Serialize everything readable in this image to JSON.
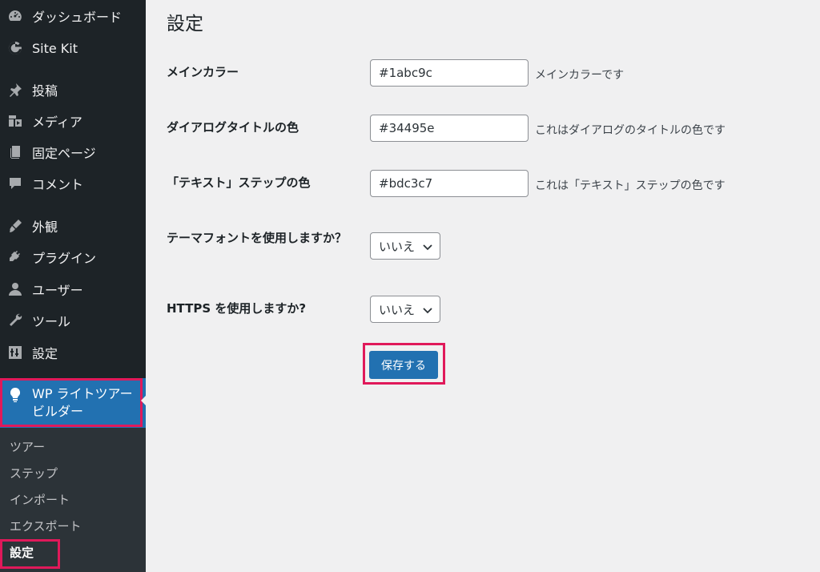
{
  "sidebar": {
    "items": [
      {
        "label": "ダッシュボード",
        "icon": "dashboard-icon"
      },
      {
        "label": "Site Kit",
        "icon": "google-g-icon"
      },
      {
        "label": "投稿",
        "icon": "pin-icon"
      },
      {
        "label": "メディア",
        "icon": "media-icon"
      },
      {
        "label": "固定ページ",
        "icon": "page-icon"
      },
      {
        "label": "コメント",
        "icon": "comment-icon"
      },
      {
        "label": "外観",
        "icon": "brush-icon"
      },
      {
        "label": "プラグイン",
        "icon": "plug-icon"
      },
      {
        "label": "ユーザー",
        "icon": "user-icon"
      },
      {
        "label": "ツール",
        "icon": "wrench-icon"
      },
      {
        "label": "設定",
        "icon": "settings-sliders-icon"
      }
    ],
    "active": {
      "label_line1": "WP ライトツアー",
      "label_line2": "ビルダー",
      "icon": "lightbulb-icon"
    },
    "submenu": [
      {
        "label": "ツアー"
      },
      {
        "label": "ステップ"
      },
      {
        "label": "インポート"
      },
      {
        "label": "エクスポート"
      },
      {
        "label": "設定"
      }
    ]
  },
  "main": {
    "title": "設定",
    "fields": [
      {
        "label": "メインカラー",
        "value": "#1abc9c",
        "description": "メインカラーです"
      },
      {
        "label": "ダイアログタイトルの色",
        "value": "#34495e",
        "description": "これはダイアログのタイトルの色です"
      },
      {
        "label": "「テキスト」ステップの色",
        "value": "#bdc3c7",
        "description": "これは「テキスト」ステップの色です"
      }
    ],
    "selects": [
      {
        "label": "テーマフォントを使用しますか？",
        "value": "いいえ"
      },
      {
        "label": "HTTPS を使用しますか?",
        "value": "いいえ"
      }
    ],
    "save_label": "保存する"
  },
  "colors": {
    "accent": "#2271b1",
    "highlight": "#e0195a",
    "sidebar": "#1d2327"
  }
}
